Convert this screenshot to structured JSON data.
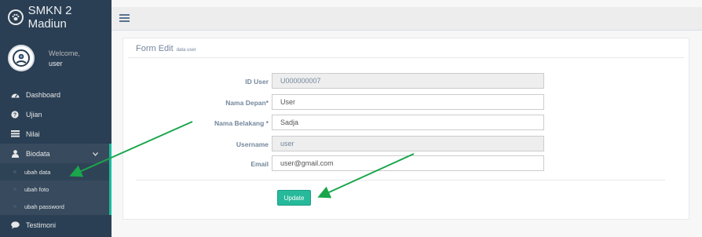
{
  "brand": {
    "title": "SMKN 2 Madiun",
    "icon": "paw-icon"
  },
  "profile": {
    "welcome": "Welcome,",
    "username": "user"
  },
  "sidebar": {
    "items": [
      {
        "label": "Dashboard",
        "icon": "dashboard-icon"
      },
      {
        "label": "Ujian",
        "icon": "question-icon"
      },
      {
        "label": "Nilai",
        "icon": "table-icon"
      },
      {
        "label": "Biodata",
        "icon": "user-icon"
      },
      {
        "label": "Testimoni",
        "icon": "comment-icon"
      }
    ],
    "submenu": [
      {
        "label": "ubah data"
      },
      {
        "label": "ubah foto"
      },
      {
        "label": "ubah password"
      }
    ]
  },
  "form": {
    "title": "Form Edit",
    "subtitle": "data user",
    "fields": [
      {
        "label": "ID User",
        "value": "U000000007",
        "readonly": true
      },
      {
        "label": "Nama Depan*",
        "value": "User",
        "readonly": false
      },
      {
        "label": "Nama Belakang *",
        "value": "Sadja",
        "readonly": false
      },
      {
        "label": "Username",
        "value": "user",
        "readonly": true
      },
      {
        "label": "Email",
        "value": "user@gmail.com",
        "readonly": false
      }
    ],
    "submit_label": "Update"
  },
  "colors": {
    "sidebar": "#2a3f54",
    "accent": "#1abb9c",
    "button": "#26b99a",
    "annotation_arrow": "#1aa64b"
  }
}
